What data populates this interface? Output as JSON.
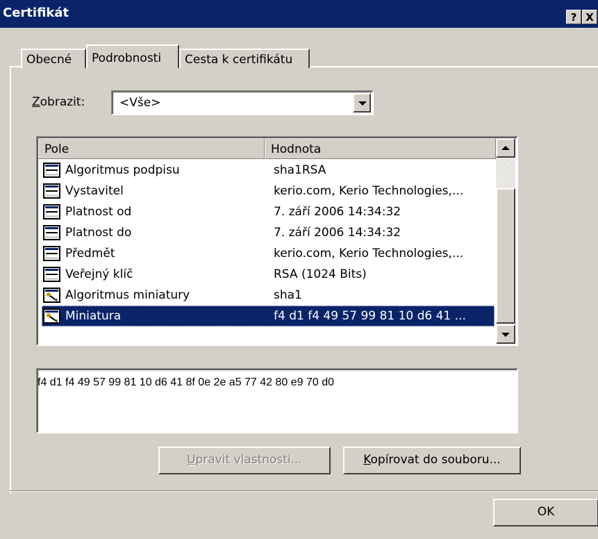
{
  "window": {
    "title": "Certifikát",
    "help_button": "?",
    "close_button": "X"
  },
  "tabs": [
    {
      "label": "Obecné",
      "active": false
    },
    {
      "label": "Podrobnosti",
      "active": true
    },
    {
      "label": "Cesta k certifikátu",
      "active": false
    }
  ],
  "show": {
    "label_mnemonic": "Z",
    "label_rest": "obrazit:",
    "value": "<Vše>"
  },
  "list": {
    "columns": [
      "Pole",
      "Hodnota"
    ],
    "rows": [
      {
        "name": "Algoritmus podpisu",
        "value": "sha1RSA",
        "icon": "field-icon"
      },
      {
        "name": "Vystavitel",
        "value": "kerio.com, Kerio Technologies,...",
        "icon": "field-icon"
      },
      {
        "name": "Platnost od",
        "value": "7. září 2006 14:34:32",
        "icon": "field-icon"
      },
      {
        "name": "Platnost do",
        "value": "7. září 2006 14:34:32",
        "icon": "field-icon"
      },
      {
        "name": "Předmět",
        "value": "kerio.com, Kerio Technologies,...",
        "icon": "field-icon"
      },
      {
        "name": "Veřejný klíč",
        "value": "RSA (1024 Bits)",
        "icon": "field-icon"
      },
      {
        "name": "Algoritmus miniatury",
        "value": "sha1",
        "icon": "property-icon"
      },
      {
        "name": "Miniatura",
        "value": "f4 d1 f4 49 57 99 81 10 d6 41 ...",
        "icon": "property-icon",
        "selected": true
      }
    ]
  },
  "detail_text": "f4 d1 f4 49 57 99 81 10 d6 41 8f 0e 2e a5 77 42 80 e9 70 d0",
  "buttons": {
    "edit_mnemonic": "U",
    "edit_rest": "pravit vlastnosti...",
    "copy_mnemonic": "K",
    "copy_rest": "opírovat do souboru...",
    "ok": "OK"
  },
  "colors": {
    "titlebar": "#0a246a",
    "selection": "#0a246a",
    "face": "#d4d0c8"
  }
}
